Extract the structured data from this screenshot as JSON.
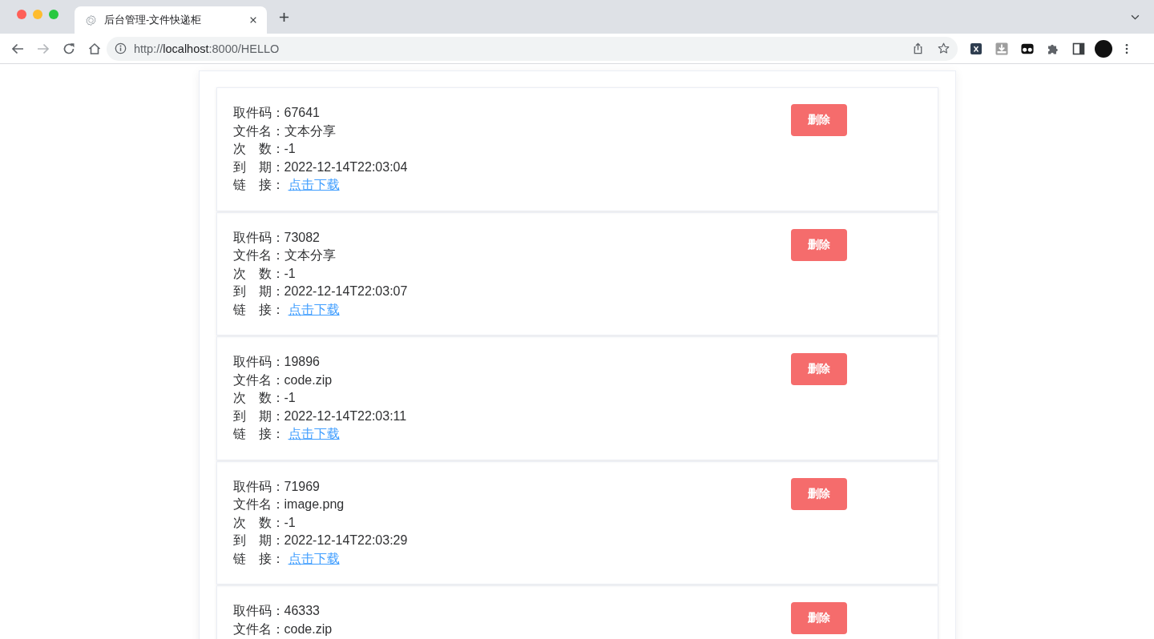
{
  "browser": {
    "tabs": [
      {
        "title": "后台管理-文件快递柜",
        "selected": true
      }
    ],
    "nav_buttons": [
      {
        "kind": "back",
        "disabled": false
      },
      {
        "kind": "forward",
        "disabled": true
      },
      {
        "kind": "reload",
        "disabled": false
      },
      {
        "kind": "home",
        "disabled": false
      }
    ],
    "address": {
      "prefix": "http://",
      "host": "localhost",
      "suffix": ":8000/HELLO"
    }
  },
  "records": [
    {
      "fields": [
        {
          "kind": "text",
          "label": "取件码：",
          "value": "67641"
        },
        {
          "kind": "text",
          "label": "文件名：",
          "value": "文本分享"
        },
        {
          "kind": "text",
          "label": "次　数：",
          "value": "-1"
        },
        {
          "kind": "text",
          "label": "到　期：",
          "value": "2022-12-14T22:03:04"
        },
        {
          "kind": "link",
          "label": "链　接：",
          "value": "点击下载"
        }
      ],
      "button": "删除"
    },
    {
      "fields": [
        {
          "kind": "text",
          "label": "取件码：",
          "value": "73082"
        },
        {
          "kind": "text",
          "label": "文件名：",
          "value": "文本分享"
        },
        {
          "kind": "text",
          "label": "次　数：",
          "value": "-1"
        },
        {
          "kind": "text",
          "label": "到　期：",
          "value": "2022-12-14T22:03:07"
        },
        {
          "kind": "link",
          "label": "链　接：",
          "value": "点击下载"
        }
      ],
      "button": "删除"
    },
    {
      "fields": [
        {
          "kind": "text",
          "label": "取件码：",
          "value": "19896"
        },
        {
          "kind": "text",
          "label": "文件名：",
          "value": "code.zip"
        },
        {
          "kind": "text",
          "label": "次　数：",
          "value": "-1"
        },
        {
          "kind": "text",
          "label": "到　期：",
          "value": "2022-12-14T22:03:11"
        },
        {
          "kind": "link",
          "label": "链　接：",
          "value": "点击下载"
        }
      ],
      "button": "删除"
    },
    {
      "fields": [
        {
          "kind": "text",
          "label": "取件码：",
          "value": "71969"
        },
        {
          "kind": "text",
          "label": "文件名：",
          "value": "image.png"
        },
        {
          "kind": "text",
          "label": "次　数：",
          "value": "-1"
        },
        {
          "kind": "text",
          "label": "到　期：",
          "value": "2022-12-14T22:03:29"
        },
        {
          "kind": "link",
          "label": "链　接：",
          "value": "点击下载"
        }
      ],
      "button": "删除"
    },
    {
      "fields": [
        {
          "kind": "text",
          "label": "取件码：",
          "value": "46333"
        },
        {
          "kind": "text",
          "label": "文件名：",
          "value": "code.zip"
        }
      ],
      "button": "删除"
    }
  ]
}
